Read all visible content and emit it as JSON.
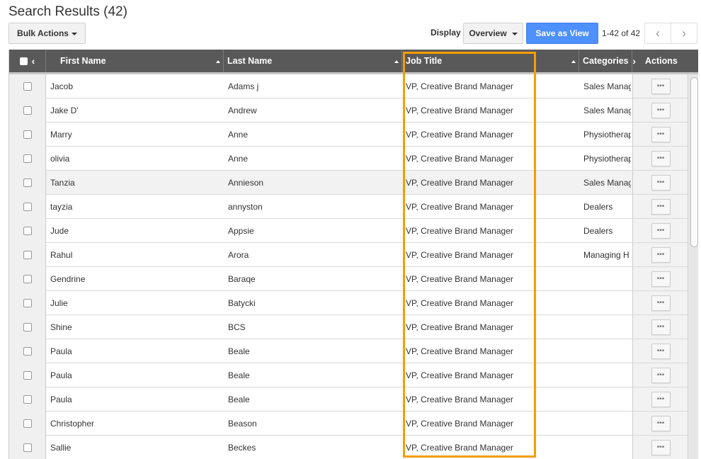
{
  "page": {
    "title": "Search Results (42)"
  },
  "toolbar": {
    "bulk_actions_label": "Bulk Actions",
    "display_label": "Display",
    "display_value": "Overview",
    "save_view_label": "Save as View",
    "range_text": "1-42 of 42",
    "prev_icon": "‹",
    "next_icon": "›"
  },
  "colors": {
    "header_bg": "#595959",
    "primary_button": "#4d90fe",
    "highlight_border": "#f59d00"
  },
  "grid": {
    "columns": {
      "first_name": "First Name",
      "last_name": "Last Name",
      "job_title": "Job Title",
      "categories": "Categories",
      "actions": "Actions"
    },
    "scroll_left_icon": "‹",
    "scroll_right_icon": "›",
    "actions_button_label": "•••",
    "rows": [
      {
        "first": "Jacob",
        "last": "Adams j",
        "job": "VP, Creative Brand Manager",
        "category": "Sales Manag"
      },
      {
        "first": "Jake D'",
        "last": "Andrew",
        "job": "VP, Creative Brand Manager",
        "category": "Sales Manag"
      },
      {
        "first": "Marry",
        "last": "Anne",
        "job": "VP, Creative Brand Manager",
        "category": "Physiotherap"
      },
      {
        "first": "olivia",
        "last": "Anne",
        "job": "VP, Creative Brand Manager",
        "category": "Physiotherap"
      },
      {
        "first": "Tanzia",
        "last": "Annieson",
        "job": "VP, Creative Brand Manager",
        "category": "Sales Manag"
      },
      {
        "first": "tayzia",
        "last": "annyston",
        "job": "VP, Creative Brand Manager",
        "category": "Dealers"
      },
      {
        "first": "Jude",
        "last": "Appsie",
        "job": "VP, Creative Brand Manager",
        "category": "Dealers"
      },
      {
        "first": "Rahul",
        "last": "Arora",
        "job": "VP, Creative Brand Manager",
        "category": "Managing H"
      },
      {
        "first": "Gendrine",
        "last": "Baraqe",
        "job": "VP, Creative Brand Manager",
        "category": ""
      },
      {
        "first": "Julie",
        "last": "Batycki",
        "job": "VP, Creative Brand Manager",
        "category": ""
      },
      {
        "first": "Shine",
        "last": "BCS",
        "job": "VP, Creative Brand Manager",
        "category": ""
      },
      {
        "first": "Paula",
        "last": "Beale",
        "job": "VP, Creative Brand Manager",
        "category": ""
      },
      {
        "first": "Paula",
        "last": "Beale",
        "job": "VP, Creative Brand Manager",
        "category": ""
      },
      {
        "first": "Paula",
        "last": "Beale",
        "job": "VP, Creative Brand Manager",
        "category": ""
      },
      {
        "first": "Christopher",
        "last": "Beason",
        "job": "VP, Creative Brand Manager",
        "category": ""
      },
      {
        "first": "Sallie",
        "last": "Beckes",
        "job": "VP, Creative Brand Manager",
        "category": ""
      }
    ],
    "highlighted_row_index": 4
  }
}
